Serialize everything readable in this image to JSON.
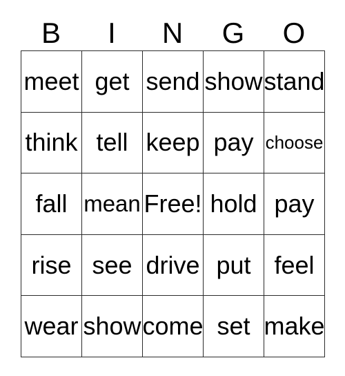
{
  "card": {
    "title": "BINGO Card",
    "background_color": "#ffffff",
    "text_color": "#000000",
    "border_color": "#2b2b2b"
  },
  "header": {
    "letters": [
      "B",
      "I",
      "N",
      "G",
      "O"
    ]
  },
  "grid": {
    "columns": 5,
    "rows": 5,
    "free_space_label": "Free!",
    "free_space_position": {
      "row": 3,
      "column": 3
    },
    "cells": [
      [
        {
          "text": "meet",
          "size": "normal"
        },
        {
          "text": "get",
          "size": "normal"
        },
        {
          "text": "send",
          "size": "normal"
        },
        {
          "text": "show",
          "size": "normal"
        },
        {
          "text": "stand",
          "size": "normal"
        }
      ],
      [
        {
          "text": "think",
          "size": "normal"
        },
        {
          "text": "tell",
          "size": "normal"
        },
        {
          "text": "keep",
          "size": "normal"
        },
        {
          "text": "pay",
          "size": "normal"
        },
        {
          "text": "choose",
          "size": "small"
        }
      ],
      [
        {
          "text": "fall",
          "size": "normal"
        },
        {
          "text": "mean",
          "size": "medium"
        },
        {
          "text": "Free!",
          "size": "normal"
        },
        {
          "text": "hold",
          "size": "normal"
        },
        {
          "text": "pay",
          "size": "normal"
        }
      ],
      [
        {
          "text": "rise",
          "size": "normal"
        },
        {
          "text": "see",
          "size": "normal"
        },
        {
          "text": "drive",
          "size": "normal"
        },
        {
          "text": "put",
          "size": "normal"
        },
        {
          "text": "feel",
          "size": "normal"
        }
      ],
      [
        {
          "text": "wear",
          "size": "normal"
        },
        {
          "text": "show",
          "size": "normal"
        },
        {
          "text": "come",
          "size": "normal"
        },
        {
          "text": "set",
          "size": "normal"
        },
        {
          "text": "make",
          "size": "normal"
        }
      ]
    ]
  }
}
